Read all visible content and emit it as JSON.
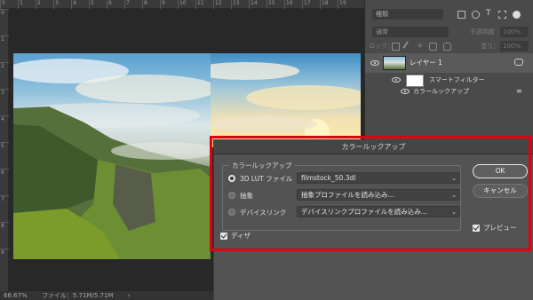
{
  "ruler": {
    "top_ticks": [
      "0",
      "1",
      "2",
      "3",
      "4",
      "5",
      "6",
      "7",
      "8",
      "9",
      "10",
      "11",
      "12",
      "13",
      "14",
      "15",
      "16",
      "17",
      "18",
      "19"
    ],
    "left_ticks": [
      "0",
      "1",
      "2",
      "3",
      "4",
      "5",
      "6",
      "7",
      "8",
      "9"
    ]
  },
  "status": {
    "zoom": "66.67%",
    "file": "ファイル：5.71M/5.71M",
    "arrow": "›"
  },
  "layers_panel": {
    "search_placeholder": "種類",
    "blend_mode": "通常",
    "opacity_label": "不透明度",
    "opacity_value": "100%",
    "lock_label": "ロック：",
    "fill_label": "塗り：",
    "fill_value": "100%",
    "layer_name": "レイヤー 1",
    "smart_filter_label": "スマートフィルター",
    "filter_name": "カラールックアップ"
  },
  "dialog": {
    "title": "カラールックアップ",
    "group_title": "カラールックアップ",
    "options": [
      {
        "label": "3D LUT ファイル",
        "selected": true,
        "value": "filmstock_50.3dl"
      },
      {
        "label": "抽象",
        "selected": false,
        "value": "抽象プロファイルを読み込み..."
      },
      {
        "label": "デバイスリンク",
        "selected": false,
        "value": "デバイスリンクプロファイルを読み込み..."
      }
    ],
    "dither_label": "ディザ",
    "ok_label": "OK",
    "cancel_label": "キャンセル",
    "preview_label": "プレビュー"
  }
}
